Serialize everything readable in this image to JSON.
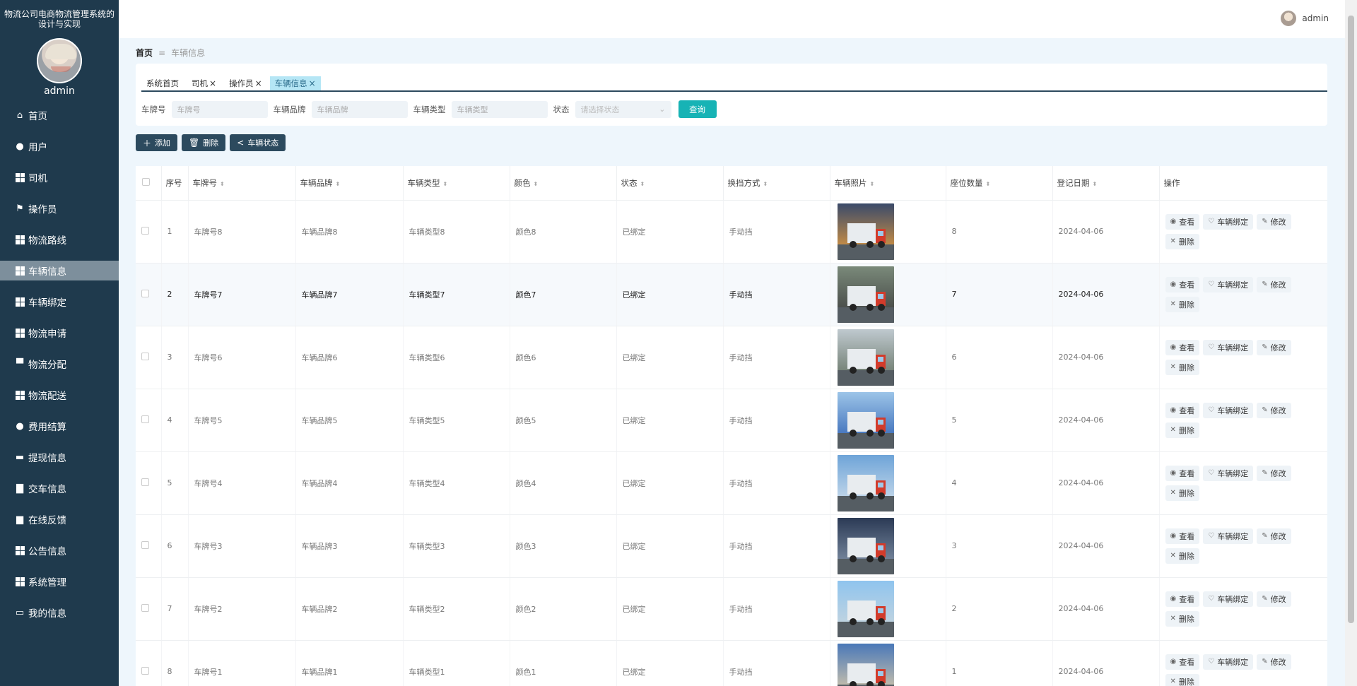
{
  "app": {
    "title": "物流公司电商物流管理系统的设计与实现",
    "user": "admin"
  },
  "sidebar": {
    "items": [
      {
        "label": "首页",
        "icon": "home-icon"
      },
      {
        "label": "用户",
        "icon": "bulb-icon"
      },
      {
        "label": "司机",
        "icon": "grid-icon"
      },
      {
        "label": "操作员",
        "icon": "flag-icon"
      },
      {
        "label": "物流路线",
        "icon": "grid-icon"
      },
      {
        "label": "车辆信息",
        "icon": "grid-icon",
        "active": true
      },
      {
        "label": "车辆绑定",
        "icon": "grid-icon"
      },
      {
        "label": "物流申请",
        "icon": "grid-icon"
      },
      {
        "label": "物流分配",
        "icon": "printer-icon"
      },
      {
        "label": "物流配送",
        "icon": "grid-icon"
      },
      {
        "label": "费用结算",
        "icon": "person-icon"
      },
      {
        "label": "提现信息",
        "icon": "monitor-icon"
      },
      {
        "label": "交车信息",
        "icon": "briefcase-icon"
      },
      {
        "label": "在线反馈",
        "icon": "wallet-icon"
      },
      {
        "label": "公告信息",
        "icon": "grid-icon"
      },
      {
        "label": "系统管理",
        "icon": "grid-icon"
      },
      {
        "label": "我的信息",
        "icon": "card-icon"
      }
    ]
  },
  "header": {
    "username": "admin"
  },
  "breadcrumb": {
    "home": "首页",
    "current": "车辆信息"
  },
  "tabs": [
    {
      "label": "系统首页",
      "closable": false
    },
    {
      "label": "司机",
      "closable": true
    },
    {
      "label": "操作员",
      "closable": true
    },
    {
      "label": "车辆信息",
      "closable": true,
      "active": true
    }
  ],
  "filters": {
    "plate_label": "车牌号",
    "plate_placeholder": "车牌号",
    "brand_label": "车辆品牌",
    "brand_placeholder": "车辆品牌",
    "type_label": "车辆类型",
    "type_placeholder": "车辆类型",
    "status_label": "状态",
    "status_placeholder": "请选择状态",
    "query": "查询"
  },
  "toolbar": {
    "add": "添加",
    "delete": "删除",
    "status": "车辆状态"
  },
  "table": {
    "columns": [
      "序号",
      "车牌号",
      "车辆品牌",
      "车辆类型",
      "颜色",
      "状态",
      "换挡方式",
      "车辆照片",
      "座位数量",
      "登记日期",
      "操作"
    ],
    "ops": {
      "view": "查看",
      "bind": "车辆绑定",
      "edit": "修改",
      "delete": "删除"
    },
    "rows": [
      {
        "idx": "1",
        "plate": "车牌号8",
        "brand": "车辆品牌8",
        "type": "车辆类型8",
        "color": "颜色8",
        "status": "已绑定",
        "gear": "手动挡",
        "seats": "8",
        "date": "2024-04-06"
      },
      {
        "idx": "2",
        "plate": "车牌号7",
        "brand": "车辆品牌7",
        "type": "车辆类型7",
        "color": "颜色7",
        "status": "已绑定",
        "gear": "手动挡",
        "seats": "7",
        "date": "2024-04-06"
      },
      {
        "idx": "3",
        "plate": "车牌号6",
        "brand": "车辆品牌6",
        "type": "车辆类型6",
        "color": "颜色6",
        "status": "已绑定",
        "gear": "手动挡",
        "seats": "6",
        "date": "2024-04-06"
      },
      {
        "idx": "4",
        "plate": "车牌号5",
        "brand": "车辆品牌5",
        "type": "车辆类型5",
        "color": "颜色5",
        "status": "已绑定",
        "gear": "手动挡",
        "seats": "5",
        "date": "2024-04-06"
      },
      {
        "idx": "5",
        "plate": "车牌号4",
        "brand": "车辆品牌4",
        "type": "车辆类型4",
        "color": "颜色4",
        "status": "已绑定",
        "gear": "手动挡",
        "seats": "4",
        "date": "2024-04-06"
      },
      {
        "idx": "6",
        "plate": "车牌号3",
        "brand": "车辆品牌3",
        "type": "车辆类型3",
        "color": "颜色3",
        "status": "已绑定",
        "gear": "手动挡",
        "seats": "3",
        "date": "2024-04-06"
      },
      {
        "idx": "7",
        "plate": "车牌号2",
        "brand": "车辆品牌2",
        "type": "车辆类型2",
        "color": "颜色2",
        "status": "已绑定",
        "gear": "手动挡",
        "seats": "2",
        "date": "2024-04-06"
      },
      {
        "idx": "8",
        "plate": "车牌号1",
        "brand": "车辆品牌1",
        "type": "车辆类型1",
        "color": "颜色1",
        "status": "已绑定",
        "gear": "手动挡",
        "seats": "1",
        "date": "2024-04-06"
      }
    ]
  },
  "colors": {
    "sidebar_bg": "#1f3a4d",
    "sidebar_active": "#7d8f9c",
    "accent": "#17b3b5",
    "dark_button": "#2c4a5e",
    "active_tab": "#b5e6f5"
  }
}
